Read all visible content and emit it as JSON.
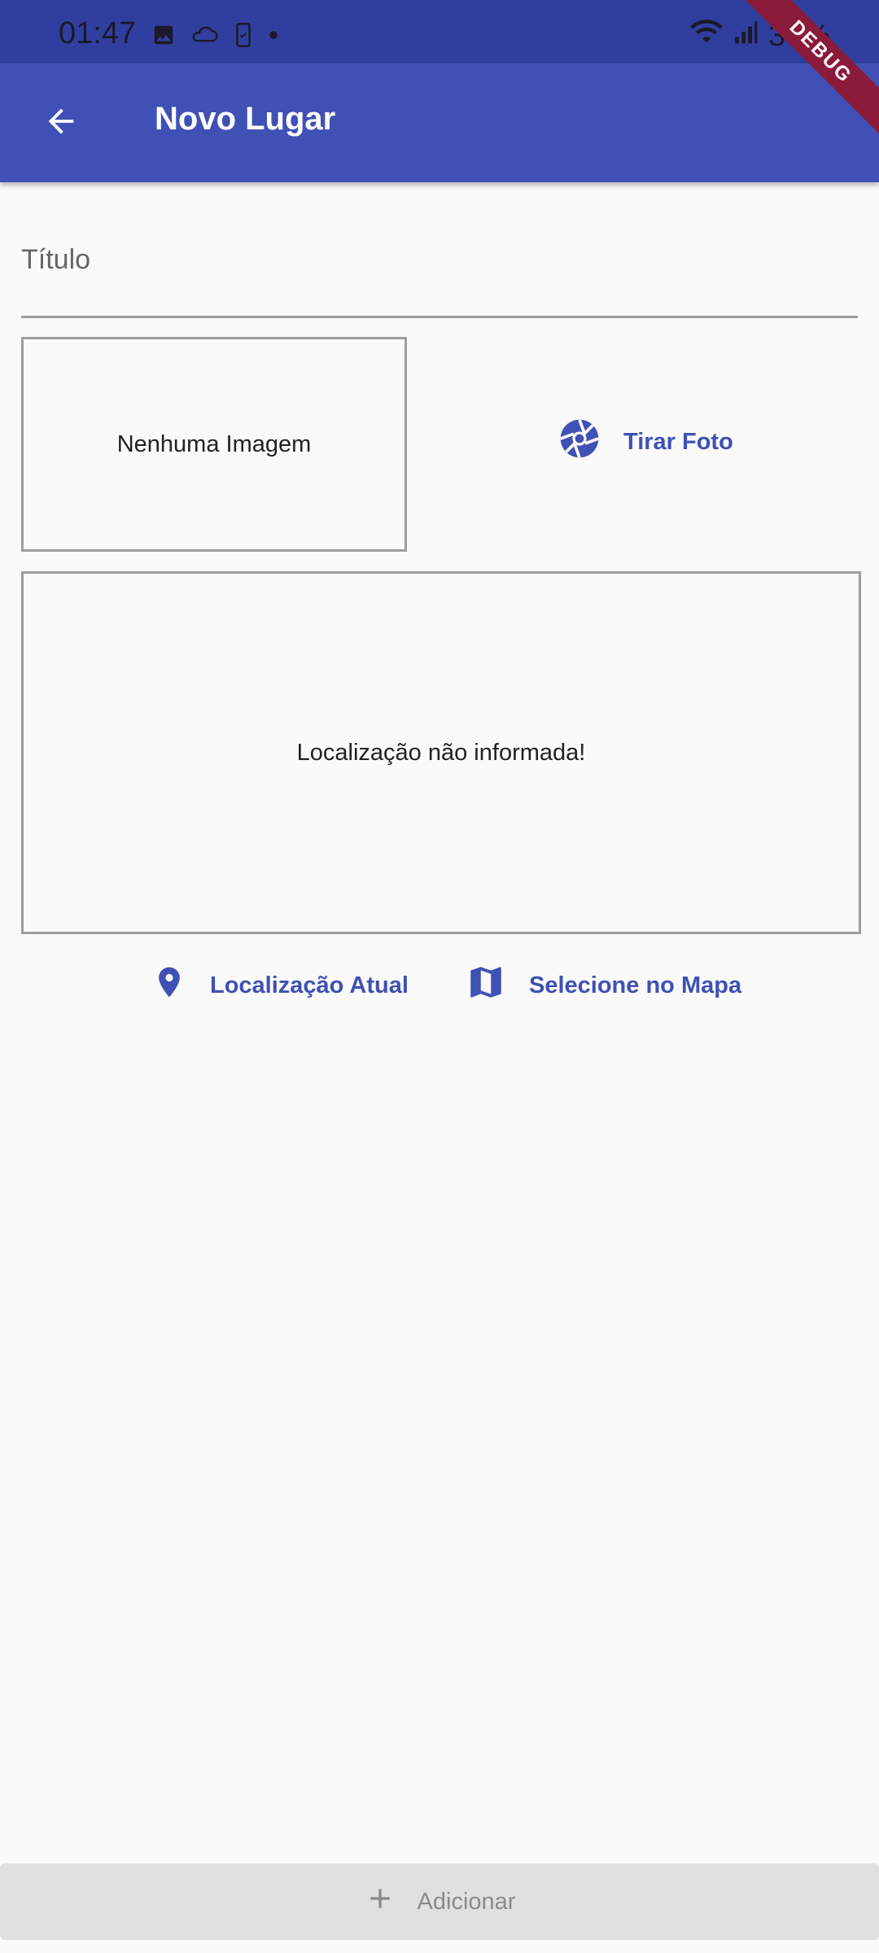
{
  "status_bar": {
    "time": "01:47",
    "battery_text": "37%",
    "icons": [
      "gallery-icon",
      "cloud-icon",
      "phone-check-icon",
      "dot-icon",
      "wifi-icon",
      "signal-icon"
    ]
  },
  "debug_banner": "DEBUG",
  "app_bar": {
    "title": "Novo Lugar",
    "back_icon": "arrow-back-icon"
  },
  "form": {
    "title_placeholder": "Título",
    "title_value": ""
  },
  "image_preview": {
    "placeholder": "Nenhuma Imagem"
  },
  "photo_button": {
    "label": "Tirar Foto",
    "icon": "camera-shutter-icon"
  },
  "location_preview": {
    "placeholder": "Localização não informada!"
  },
  "location_buttons": {
    "current_label": "Localização Atual",
    "current_icon": "pin-icon",
    "map_label": "Selecione no Mapa",
    "map_icon": "map-icon"
  },
  "add_button": {
    "label": "Adicionar",
    "icon": "plus-icon"
  },
  "colors": {
    "primary": "#3f51b5",
    "status_bar": "#303f9f",
    "disabled_bg": "#e0e0e0",
    "disabled_text": "#8a8a8a",
    "debug": "#8b1b3a"
  }
}
